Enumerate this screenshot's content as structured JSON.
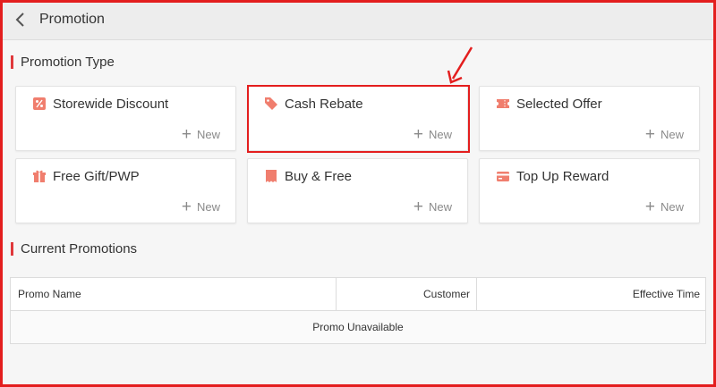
{
  "header": {
    "title": "Promotion"
  },
  "sections": {
    "types": "Promotion Type",
    "current": "Current Promotions"
  },
  "cards": [
    {
      "label": "Storewide Discount",
      "new": "New",
      "icon": "percent-tag-icon"
    },
    {
      "label": "Cash Rebate",
      "new": "New",
      "icon": "price-tag-icon"
    },
    {
      "label": "Selected Offer",
      "new": "New",
      "icon": "ticket-icon"
    },
    {
      "label": "Free Gift/PWP",
      "new": "New",
      "icon": "gift-icon"
    },
    {
      "label": "Buy & Free",
      "new": "New",
      "icon": "receipt-icon"
    },
    {
      "label": "Top Up Reward",
      "new": "New",
      "icon": "card-icon"
    }
  ],
  "table": {
    "columns": [
      "Promo Name",
      "Customer",
      "Effective Time"
    ],
    "empty": "Promo Unavailable"
  },
  "colors": {
    "accent": "#e0383b",
    "icon": "#f07e6e",
    "annotation": "#e31e1e"
  }
}
